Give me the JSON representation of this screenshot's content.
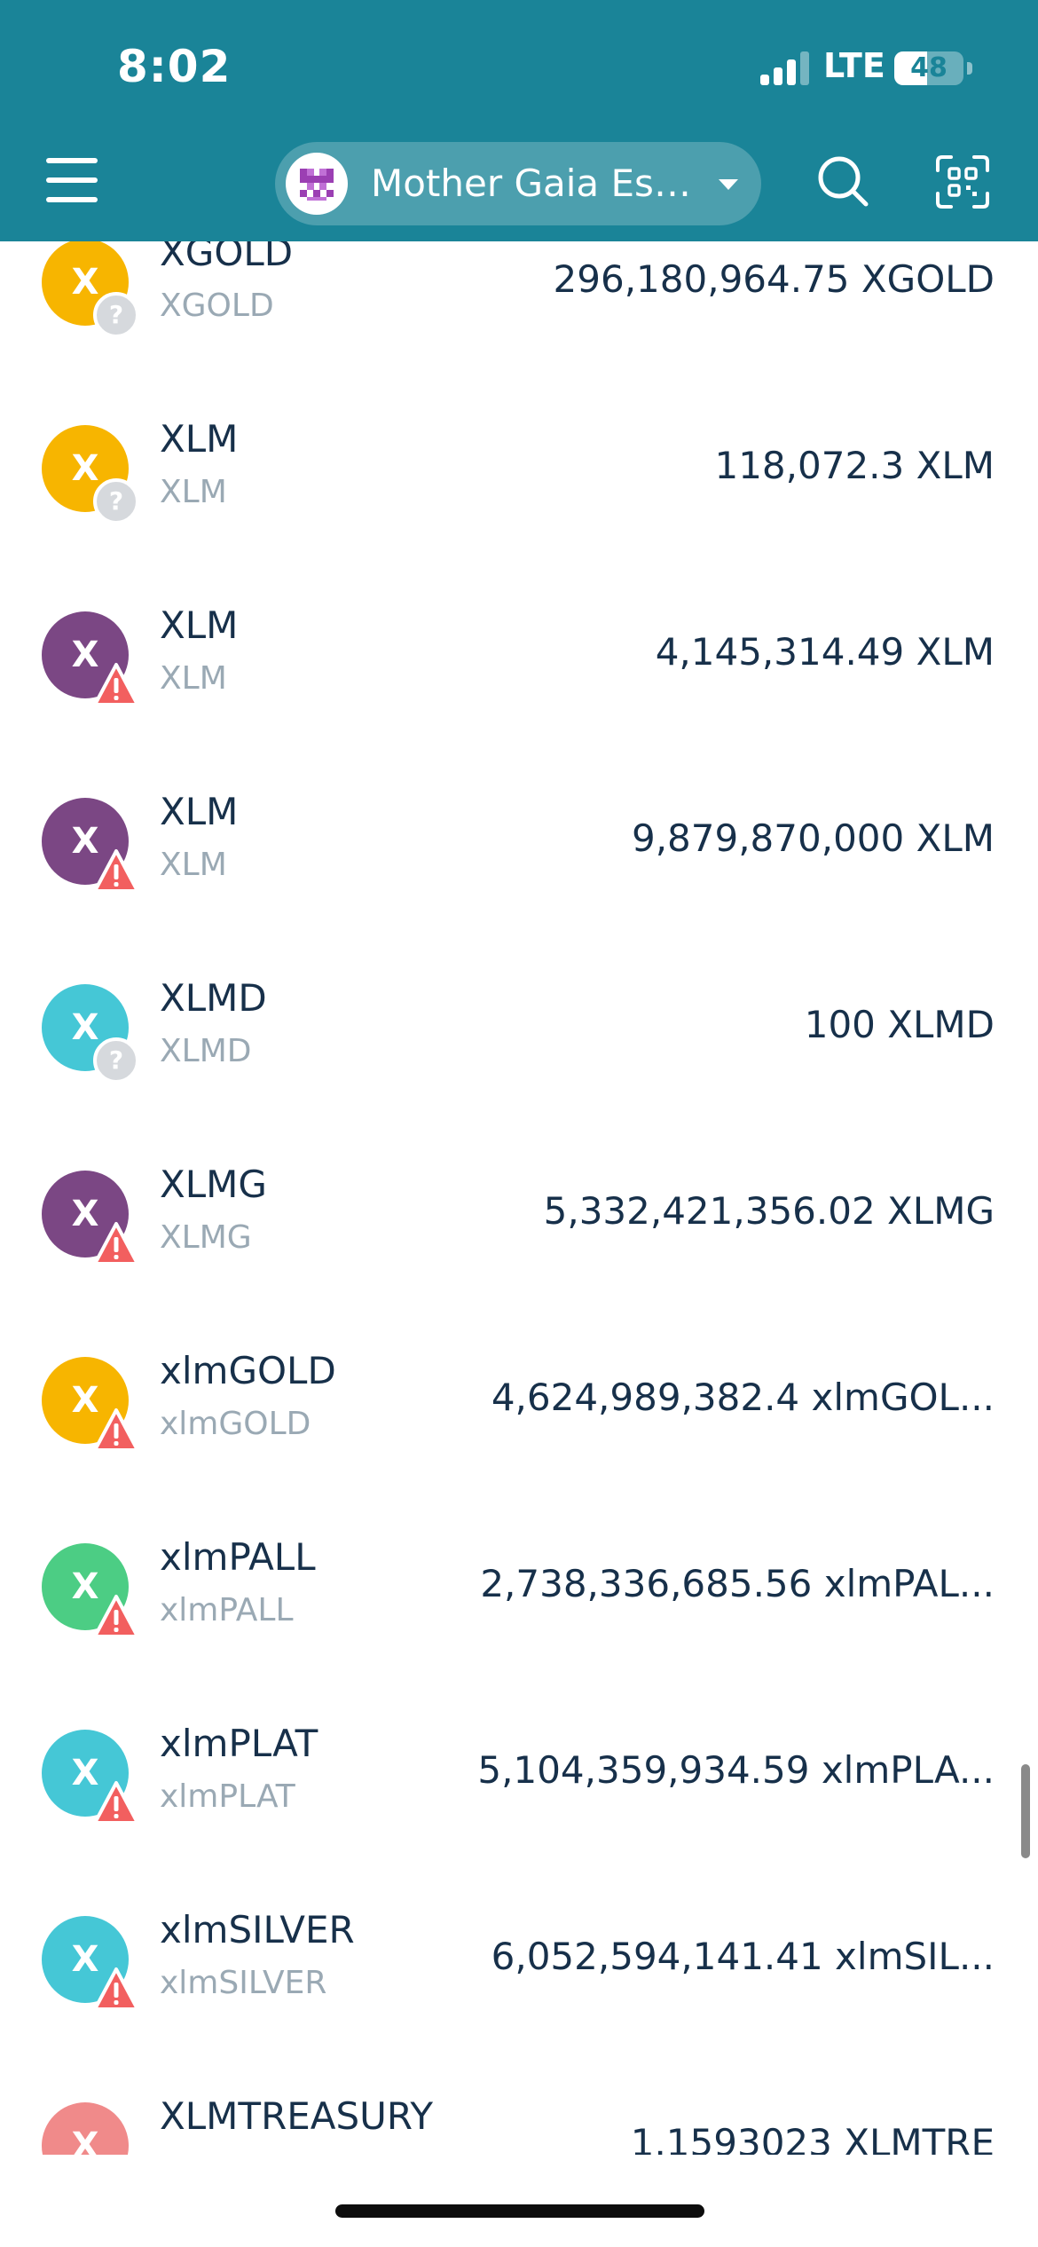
{
  "status_bar": {
    "time": "8:02",
    "network": "LTE",
    "battery": "48",
    "battery_level_percent": 48
  },
  "header": {
    "account_name": "Mother Gaia Es…",
    "menu_icon": "hamburger-menu-icon",
    "search_icon": "search-icon",
    "scan_icon": "qr-scan-icon",
    "background_color": "#1a8498"
  },
  "assets": [
    {
      "name": "XGOLD",
      "code": "XGOLD",
      "balance": "296,180,964.75 XGOLD",
      "icon_letter": "X",
      "icon_color": "#f7b500",
      "badge": "unknown"
    },
    {
      "name": "XLM",
      "code": "XLM",
      "balance": "118,072.3 XLM",
      "icon_letter": "X",
      "icon_color": "#f7b500",
      "badge": "unknown"
    },
    {
      "name": "XLM",
      "code": "XLM",
      "balance": "4,145,314.49 XLM",
      "icon_letter": "X",
      "icon_color": "#7b4784",
      "badge": "warning"
    },
    {
      "name": "XLM",
      "code": "XLM",
      "balance": "9,879,870,000 XLM",
      "icon_letter": "X",
      "icon_color": "#7b4784",
      "badge": "warning"
    },
    {
      "name": "XLMD",
      "code": "XLMD",
      "balance": "100 XLMD",
      "icon_letter": "X",
      "icon_color": "#45c7d6",
      "badge": "unknown"
    },
    {
      "name": "XLMG",
      "code": "XLMG",
      "balance": "5,332,421,356.02 XLMG",
      "icon_letter": "X",
      "icon_color": "#7b4784",
      "badge": "warning"
    },
    {
      "name": "xlmGOLD",
      "code": "xlmGOLD",
      "balance": "4,624,989,382.4 xlmGOL...",
      "icon_letter": "X",
      "icon_color": "#f7b500",
      "badge": "warning"
    },
    {
      "name": "xlmPALL",
      "code": "xlmPALL",
      "balance": "2,738,336,685.56 xlmPAL...",
      "icon_letter": "X",
      "icon_color": "#4ccd84",
      "badge": "warning"
    },
    {
      "name": "xlmPLAT",
      "code": "xlmPLAT",
      "balance": "5,104,359,934.59 xlmPLA...",
      "icon_letter": "X",
      "icon_color": "#45c7d6",
      "badge": "warning"
    },
    {
      "name": "xlmSILVER",
      "code": "xlmSILVER",
      "balance": "6,052,594,141.41 xlmSIL...",
      "icon_letter": "X",
      "icon_color": "#45c7d6",
      "badge": "warning"
    },
    {
      "name": "XLMTREASURY",
      "code": "",
      "balance": "1.1593023 XLMTRE",
      "icon_letter": "X",
      "icon_color": "#f08a8a",
      "badge": "none"
    }
  ]
}
